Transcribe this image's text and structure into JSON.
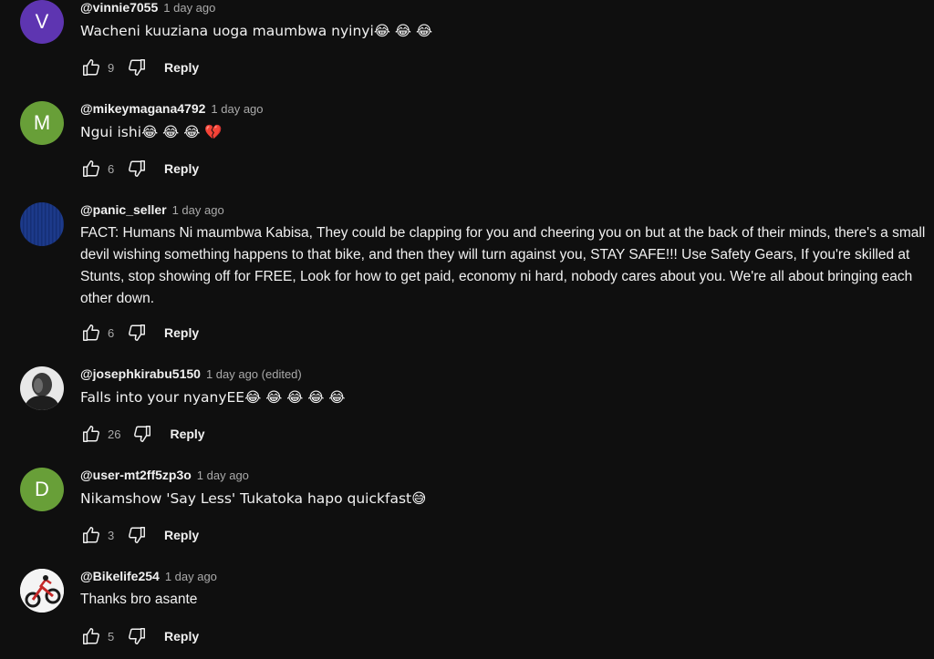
{
  "ui": {
    "reply_label": "Reply",
    "like_icon": "thumb-up-icon",
    "dislike_icon": "thumb-down-icon"
  },
  "comments": [
    {
      "handle": "@vinnie7055",
      "time": "1 day ago",
      "text": "Wacheni kuuziana uoga maumbwa nyinyi😂 😂 😂",
      "likes": "9",
      "avatar_letter": "V",
      "avatar_color": "#5e35b1"
    },
    {
      "handle": "@mikeymagana4792",
      "time": "1 day ago",
      "text": "Ngui ishi😂 😂 😂 💔",
      "likes": "6",
      "avatar_letter": "M",
      "avatar_color": "#689f38"
    },
    {
      "handle": "@panic_seller",
      "time": "1 day ago",
      "text": "FACT: Humans Ni maumbwa Kabisa, They could be clapping for you and cheering you on but at the back of their minds, there's a small devil wishing something happens to that bike, and then they will turn against you, STAY SAFE!!! Use Safety Gears, If you're skilled at Stunts, stop showing off for FREE, Look for how to get paid, economy ni hard, nobody cares about you. We're all about bringing each other down.",
      "likes": "6",
      "avatar_color": "#1a3a8a"
    },
    {
      "handle": "@josephkirabu5150",
      "time": "1 day ago (edited)",
      "text": "Falls into your nyanyEE😂 😂 😂 😂 😂",
      "likes": "26",
      "avatar_color": "#3a3a3a"
    },
    {
      "handle": "@user-mt2ff5zp3o",
      "time": "1 day ago",
      "text": "Nikamshow 'Say Less' Tukatoka hapo quickfast😅",
      "likes": "3",
      "avatar_letter": "D",
      "avatar_color": "#689f38"
    },
    {
      "handle": "@Bikelife254",
      "time": "1 day ago",
      "text": "Thanks bro asante",
      "likes": "5",
      "avatar_color": "#ffffff"
    }
  ]
}
